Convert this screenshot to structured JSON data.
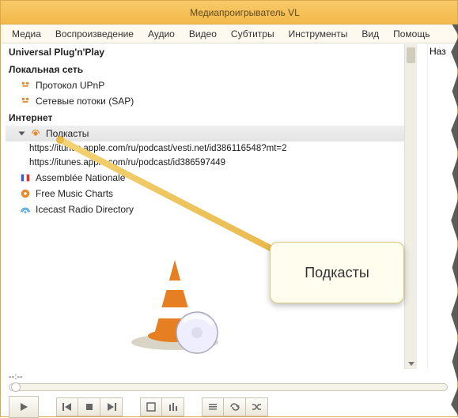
{
  "window": {
    "title": "Медиапроигрыватель VL"
  },
  "menu": {
    "media": "Медиа",
    "playback": "Воспроизведение",
    "audio": "Аудио",
    "video": "Видео",
    "subtitles": "Субтитры",
    "tools": "Инструменты",
    "view": "Вид",
    "help": "Помощь"
  },
  "sidebar": {
    "header": "Universal Plug'n'Play",
    "localNet": "Локальная сеть",
    "items_local": [
      {
        "label": "Протокол UPnP"
      },
      {
        "label": "Сетевые потоки (SAP)"
      }
    ],
    "internet": "Интернет",
    "podcasts": "Подкасты",
    "podcast_urls": [
      "https://itunes.apple.com/ru/podcast/vesti.net/id386116548?mt=2",
      "https://itunes.apple.com/ru/podcast/id386597449"
    ],
    "items_net": [
      {
        "label": "Assemblée Nationale"
      },
      {
        "label": "Free Music Charts"
      },
      {
        "label": "Icecast Radio Directory"
      }
    ]
  },
  "rightcol": {
    "header": "Наз"
  },
  "callout": {
    "text": "Подкасты"
  },
  "player": {
    "time": "--:--"
  }
}
